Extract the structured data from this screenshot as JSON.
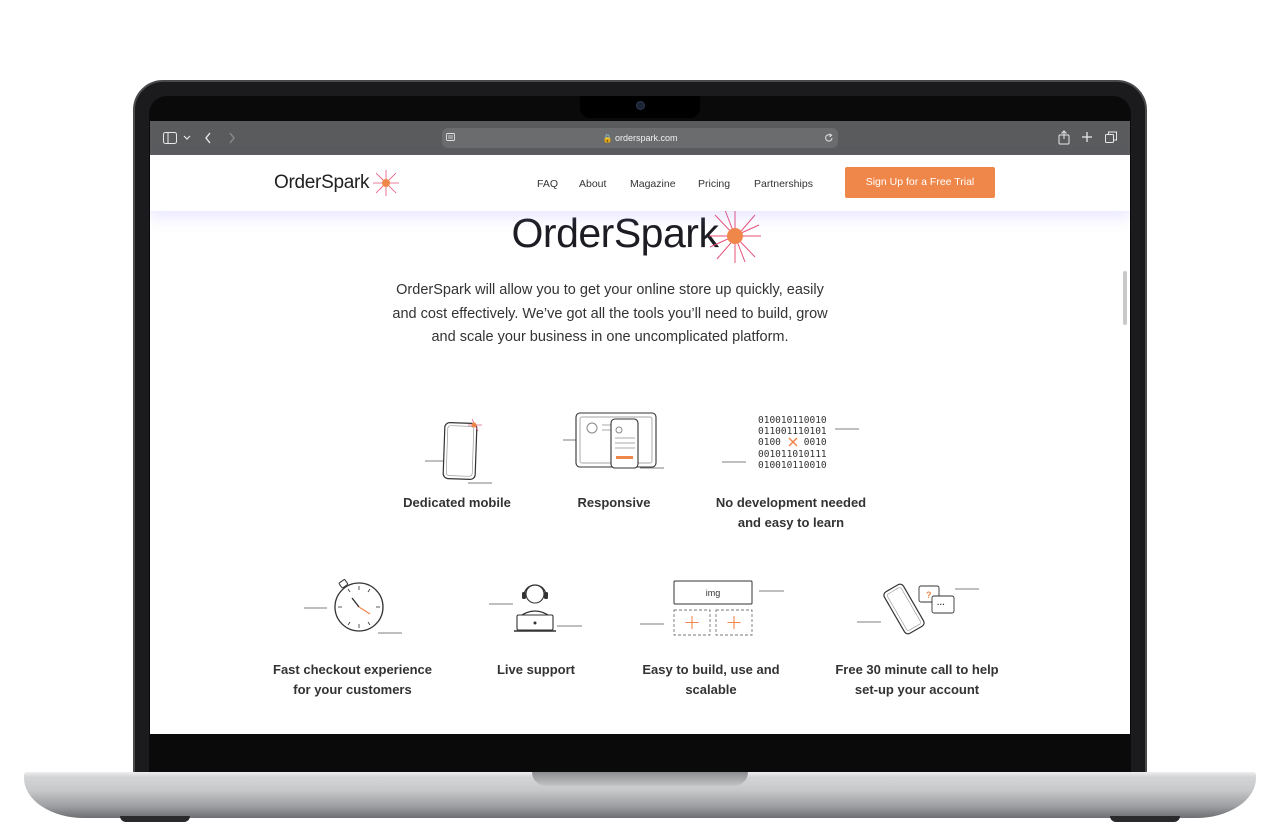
{
  "browser": {
    "url": "orderspark.com",
    "icons": [
      "sidebar-icon",
      "chevron-down-icon",
      "back-icon",
      "forward-icon",
      "reader-icon",
      "lock-icon",
      "reload-icon",
      "share-icon",
      "new-tab-icon",
      "tabs-overview-icon"
    ]
  },
  "site": {
    "logo": "OrderSpark",
    "nav": {
      "faq": "FAQ",
      "about": "About",
      "magazine": "Magazine",
      "pricing": "Pricing",
      "partnerships": "Partnerships"
    },
    "cta": "Sign Up for a Free Trial",
    "hero_logo": "OrderSpark",
    "tagline": "OrderSpark will allow you to get your online store up quickly, easily and cost effectively. We’ve got all the tools you’ll need to build, grow and scale your business in one uncomplicated platform.",
    "binary": [
      "010010110010",
      "011001110101",
      "010010100010",
      "001011010111",
      "010010110010"
    ],
    "img_label": "img",
    "features": {
      "dedicated_mobile": "Dedicated mobile",
      "responsive": "Responsive",
      "no_dev": "No development needed and easy to learn",
      "fast_checkout": "Fast checkout experience for your customers",
      "live_support": "Live support",
      "easy_build": "Easy to build, use and scalable",
      "free_call": "Free 30 minute call to help set-up your account"
    }
  },
  "colors": {
    "accent": "#f0874a",
    "spark_pink": "#e7507a",
    "toolbar": "#5a5b5d",
    "text": "#333333"
  }
}
